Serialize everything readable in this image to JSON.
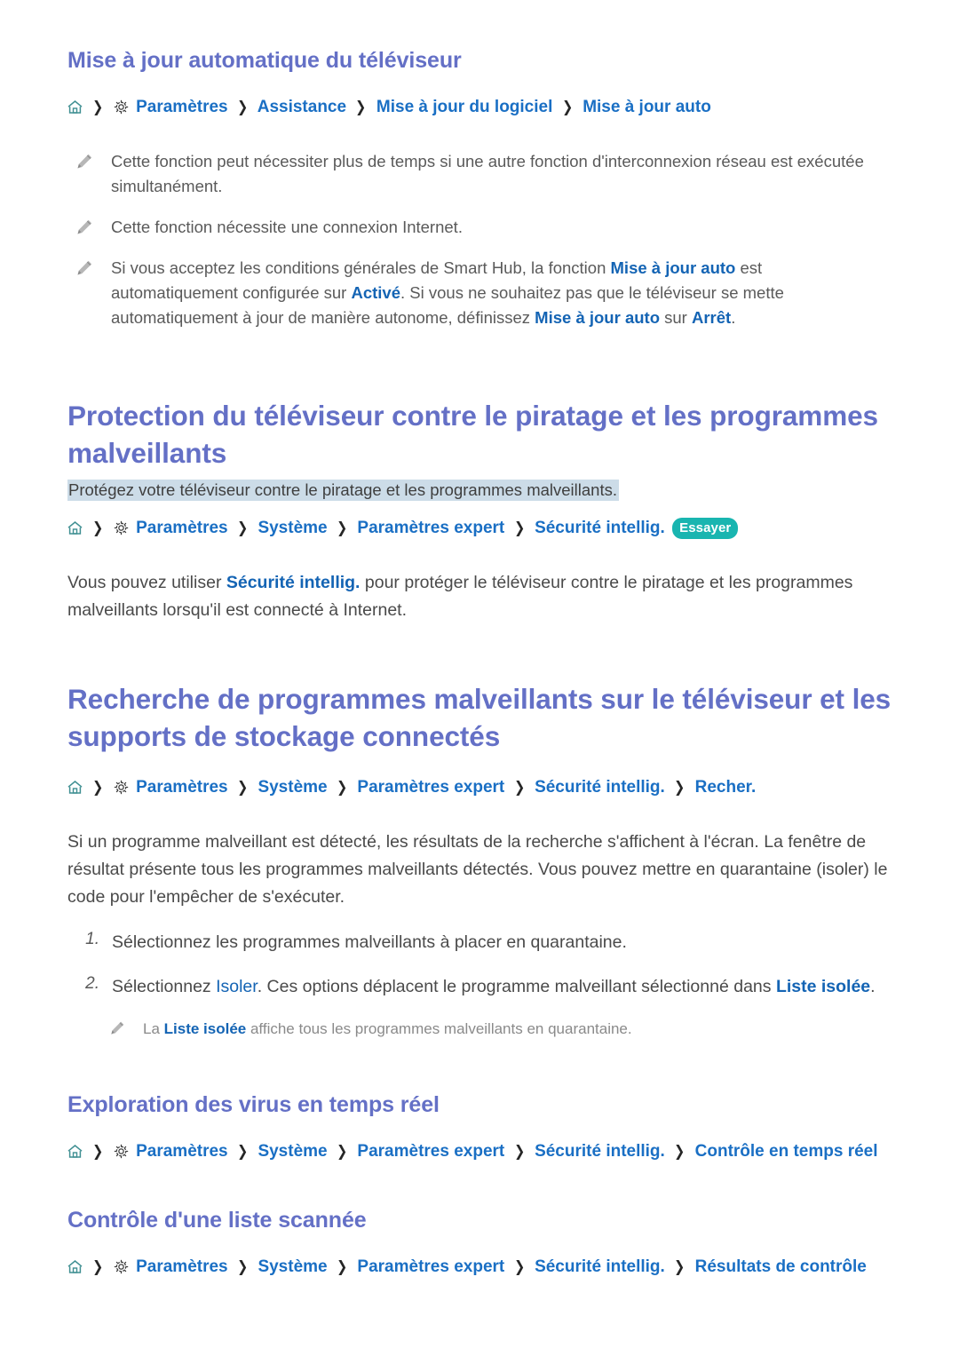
{
  "page": {
    "language": "fr"
  },
  "colors": {
    "heading": "#6470c6",
    "link": "#1a6fc4",
    "term": "#1464b4",
    "badge_bg": "#19b5b0",
    "highlight_bg": "#ccdce8",
    "body_text": "#4a4a4a",
    "note_text": "#5a5a5a",
    "subnote_text": "#8a8a8a",
    "home_icon": "#3f8f92"
  },
  "icons": {
    "home": "home-icon",
    "gear": "gear-icon",
    "pencil": "pencil-icon",
    "separator": "chevron-right-icon"
  },
  "sections": [
    {
      "id": "auto-update",
      "title": "Mise à jour automatique du téléviseur",
      "breadcrumb": [
        "Paramètres",
        "Assistance",
        "Mise à jour du logiciel",
        "Mise à jour auto"
      ],
      "notes": [
        {
          "parts": [
            {
              "t": "Cette fonction peut nécessiter plus de temps si une autre fonction d'interconnexion réseau est exécutée simultanément.",
              "style": "plain"
            }
          ]
        },
        {
          "parts": [
            {
              "t": "Cette fonction nécessite une connexion Internet.",
              "style": "plain"
            }
          ]
        },
        {
          "parts": [
            {
              "t": "Si vous acceptez les conditions générales de Smart Hub, la fonction ",
              "style": "plain"
            },
            {
              "t": "Mise à jour auto",
              "style": "term"
            },
            {
              "t": " est automatiquement configurée sur ",
              "style": "plain"
            },
            {
              "t": "Activé",
              "style": "term"
            },
            {
              "t": ". Si vous ne souhaitez pas que le téléviseur se mette automatiquement à jour de manière autonome, définissez ",
              "style": "plain"
            },
            {
              "t": "Mise à jour auto",
              "style": "term"
            },
            {
              "t": " sur ",
              "style": "plain"
            },
            {
              "t": "Arrêt",
              "style": "term"
            },
            {
              "t": ".",
              "style": "plain"
            }
          ]
        }
      ]
    },
    {
      "id": "protection",
      "title": "Protection du téléviseur contre le piratage et les programmes malveillants",
      "highlight": "Protégez votre téléviseur contre le piratage et les programmes malveillants.",
      "breadcrumb": [
        "Paramètres",
        "Système",
        "Paramètres expert",
        "Sécurité intellig."
      ],
      "badge": "Essayer",
      "body": [
        {
          "t": "Vous pouvez utiliser ",
          "style": "plain"
        },
        {
          "t": "Sécurité intellig.",
          "style": "term"
        },
        {
          "t": " pour protéger le téléviseur contre le piratage et les programmes malveillants lorsqu'il est connecté à Internet.",
          "style": "plain"
        }
      ]
    },
    {
      "id": "scan",
      "title": "Recherche de programmes malveillants sur le téléviseur et les supports de stockage connectés",
      "breadcrumb": [
        "Paramètres",
        "Système",
        "Paramètres expert",
        "Sécurité intellig.",
        "Recher."
      ],
      "body": [
        {
          "t": "Si un programme malveillant est détecté, les résultats de la recherche s'affichent à l'écran. La fenêtre de résultat présente tous les programmes malveillants détectés. Vous pouvez mettre en quarantaine (isoler) le code pour l'empêcher de s'exécuter.",
          "style": "plain"
        }
      ],
      "steps": [
        {
          "num": "1.",
          "parts": [
            {
              "t": "Sélectionnez les programmes malveillants à placer en quarantaine.",
              "style": "plain"
            }
          ]
        },
        {
          "num": "2.",
          "parts": [
            {
              "t": "Sélectionnez ",
              "style": "plain"
            },
            {
              "t": "Isoler",
              "style": "link"
            },
            {
              "t": ". Ces options déplacent le programme malveillant sélectionné dans ",
              "style": "plain"
            },
            {
              "t": "Liste isolée",
              "style": "term"
            },
            {
              "t": ".",
              "style": "plain"
            }
          ]
        }
      ],
      "subnote": [
        {
          "t": "La ",
          "style": "plain"
        },
        {
          "t": "Liste isolée",
          "style": "term"
        },
        {
          "t": " affiche tous les programmes malveillants en quarantaine.",
          "style": "plain"
        }
      ]
    },
    {
      "id": "realtime",
      "title": "Exploration des virus en temps réel",
      "breadcrumb": [
        "Paramètres",
        "Système",
        "Paramètres expert",
        "Sécurité intellig.",
        "Contrôle en temps réel"
      ]
    },
    {
      "id": "results",
      "title": "Contrôle d'une liste scannée",
      "breadcrumb": [
        "Paramètres",
        "Système",
        "Paramètres expert",
        "Sécurité intellig.",
        "Résultats de contrôle"
      ]
    }
  ]
}
